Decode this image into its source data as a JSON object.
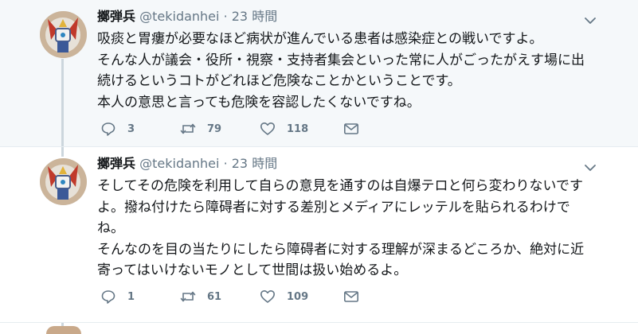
{
  "colors": {
    "text": "#14171a",
    "muted": "#657786",
    "thread": "#ccd6dd",
    "highlight_bg": "#f5f8fa"
  },
  "tweets": [
    {
      "name": "擲弾兵",
      "handle": "@tekidanhei",
      "separator": "·",
      "time": "23 時間",
      "text": "吸痰と胃瘻が必要なほど病状が進んでいる患者は感染症との戦いですよ。\nそんな人が議会・役所・視察・支持者集会といった常に人がごったがえす場に出続けるというコトがどれほど危険なことかということです。\n本人の意思と言っても危険を容認したくないですね。",
      "replies": "3",
      "retweets": "79",
      "likes": "118",
      "icons": {
        "reply": "reply-icon",
        "retweet": "retweet-icon",
        "like": "heart-icon",
        "dm": "envelope-icon",
        "menu": "chevron-down-icon"
      }
    },
    {
      "name": "擲弾兵",
      "handle": "@tekidanhei",
      "separator": "·",
      "time": "23 時間",
      "text": "そしてその危険を利用して自らの意見を通すのは自爆テロと何ら変わりないですよ。撥ね付けたら障碍者に対する差別とメディアにレッテルを貼られるわけでね。\nそんなのを目の当たりにしたら障碍者に対する理解が深まるどころか、絶対に近寄ってはいけないモノとして世間は扱い始めるよ。",
      "replies": "1",
      "retweets": "61",
      "likes": "109",
      "icons": {
        "reply": "reply-icon",
        "retweet": "retweet-icon",
        "like": "heart-icon",
        "dm": "envelope-icon",
        "menu": "chevron-down-icon"
      }
    }
  ]
}
